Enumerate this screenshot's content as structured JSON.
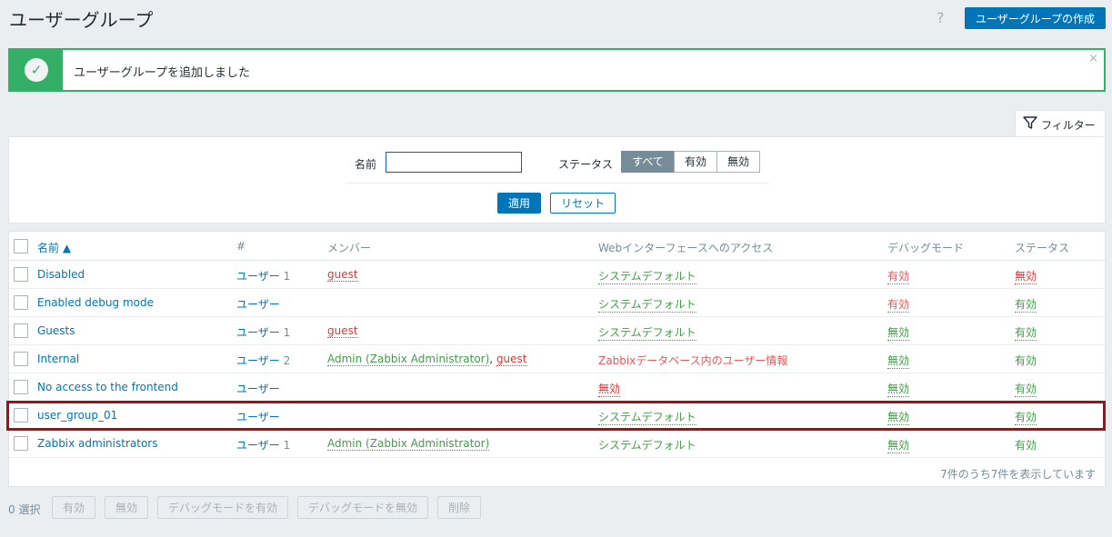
{
  "header": {
    "title": "ユーザーグループ",
    "help_icon": "?",
    "create_button": "ユーザーグループの作成"
  },
  "message": {
    "text": "ユーザーグループを追加しました",
    "close": "×"
  },
  "filter": {
    "tab_label": "フィルター",
    "name_label": "名前",
    "name_value": "",
    "status_label": "ステータス",
    "status_options": [
      "すべて",
      "有効",
      "無効"
    ],
    "status_selected": "すべて",
    "apply_label": "適用",
    "reset_label": "リセット"
  },
  "table": {
    "columns": [
      "名前 ▲",
      "#",
      "メンバー",
      "Webインターフェースへのアクセス",
      "デバッグモード",
      "ステータス"
    ],
    "rows": [
      {
        "name": "Disabled",
        "users_label": "ユーザー",
        "users_count": "1",
        "members": [
          {
            "text": "guest",
            "color": "red"
          }
        ],
        "access": "システムデフォルト",
        "access_color": "green",
        "debug": "有効",
        "debug_color": "orange",
        "status": "無効",
        "status_color": "red"
      },
      {
        "name": "Enabled debug mode",
        "users_label": "ユーザー",
        "users_count": "",
        "members": [],
        "access": "システムデフォルト",
        "access_color": "green",
        "debug": "有効",
        "debug_color": "orange",
        "status": "有効",
        "status_color": "green"
      },
      {
        "name": "Guests",
        "users_label": "ユーザー",
        "users_count": "1",
        "members": [
          {
            "text": "guest",
            "color": "red"
          }
        ],
        "access": "システムデフォルト",
        "access_color": "green",
        "debug": "無効",
        "debug_color": "green",
        "status": "有効",
        "status_color": "green"
      },
      {
        "name": "Internal",
        "users_label": "ユーザー",
        "users_count": "2",
        "members": [
          {
            "text": "Admin (Zabbix Administrator)",
            "color": "green"
          },
          {
            "text": "guest",
            "color": "red"
          }
        ],
        "access": "Zabbixデータベース内のユーザー情報",
        "access_color": "orange",
        "debug": "無効",
        "debug_color": "green",
        "status": "有効",
        "status_color": "green"
      },
      {
        "name": "No access to the frontend",
        "users_label": "ユーザー",
        "users_count": "",
        "members": [],
        "access": "無効",
        "access_color": "red",
        "debug": "無効",
        "debug_color": "green",
        "status": "有効",
        "status_color": "green"
      },
      {
        "name": "user_group_01",
        "users_label": "ユーザー",
        "users_count": "",
        "members": [],
        "access": "システムデフォルト",
        "access_color": "green",
        "debug": "無効",
        "debug_color": "green",
        "status": "有効",
        "status_color": "green"
      },
      {
        "name": "Zabbix administrators",
        "users_label": "ユーザー",
        "users_count": "1",
        "members": [
          {
            "text": "Admin (Zabbix Administrator)",
            "color": "green"
          }
        ],
        "access": "システムデフォルト",
        "access_color": "green",
        "debug": "無効",
        "debug_color": "green",
        "status": "有効",
        "status_color": "green"
      }
    ],
    "footer": "7件のうち7件を表示しています"
  },
  "actions": {
    "selected_count": "0 選択",
    "buttons": [
      "有効",
      "無効",
      "デバッグモードを有効",
      "デバッグモードを無効",
      "削除"
    ]
  },
  "colors": {
    "accent": "#0275b8",
    "success": "#34af67",
    "highlight": "#a01016"
  }
}
